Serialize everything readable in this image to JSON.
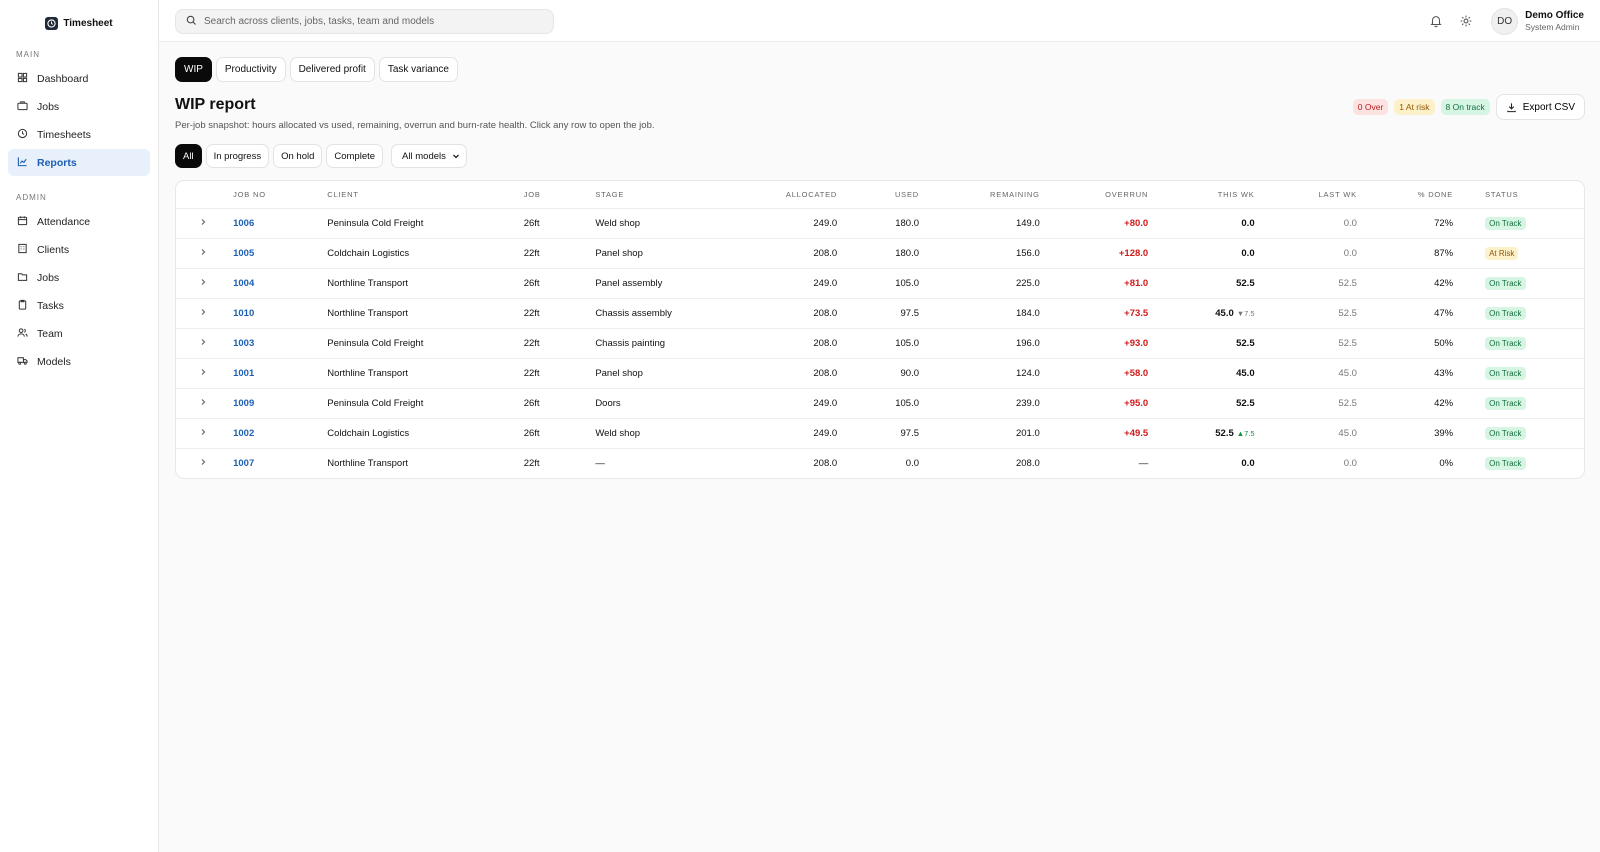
{
  "app": {
    "name": "Timesheet"
  },
  "sidebar": {
    "main_heading": "MAIN",
    "main_items": [
      {
        "label": "Dashboard",
        "icon": "dashboard-icon"
      },
      {
        "label": "Jobs",
        "icon": "briefcase-icon"
      },
      {
        "label": "Timesheets",
        "icon": "clock-icon"
      },
      {
        "label": "Reports",
        "icon": "chart-line-icon",
        "active": true
      }
    ],
    "admin_heading": "ADMIN",
    "admin_items": [
      {
        "label": "Attendance",
        "icon": "calendar-icon"
      },
      {
        "label": "Clients",
        "icon": "building-icon"
      },
      {
        "label": "Jobs",
        "icon": "folder-icon"
      },
      {
        "label": "Tasks",
        "icon": "clipboard-icon"
      },
      {
        "label": "Team",
        "icon": "users-icon"
      },
      {
        "label": "Models",
        "icon": "truck-icon"
      }
    ]
  },
  "topbar": {
    "search_placeholder": "Search across clients, jobs, tasks, team and models",
    "user": {
      "initials": "DO",
      "name": "Demo Office",
      "role": "System Admin"
    }
  },
  "report_tabs": [
    "WIP",
    "Productivity",
    "Delivered profit",
    "Task variance"
  ],
  "page": {
    "title": "WIP report",
    "subtitle": "Per-job snapshot: hours allocated vs used, remaining, overrun and burn-rate health. Click any row to open the job.",
    "summary": {
      "over": "0 Over",
      "at_risk": "1 At risk",
      "on_track": "8 On track"
    },
    "export_label": "Export CSV"
  },
  "filters": [
    "All",
    "In progress",
    "On hold",
    "Complete"
  ],
  "model_select": {
    "value": "All models"
  },
  "table": {
    "columns": [
      "JOB NO",
      "CLIENT",
      "JOB",
      "STAGE",
      "ALLOCATED",
      "USED",
      "REMAINING",
      "OVERRUN",
      "THIS WK",
      "LAST WK",
      "% DONE",
      "STATUS"
    ],
    "rows": [
      {
        "job_no": "1006",
        "client": "Peninsula Cold Freight",
        "job": "26ft",
        "stage": "Weld shop",
        "allocated": "249.0",
        "used": "180.0",
        "remaining": "149.0",
        "overrun": "+80.0",
        "this_wk": "0.0",
        "delta": "",
        "delta_dir": "",
        "last_wk": "0.0",
        "done": "72%",
        "status": "On Track",
        "status_kind": "ontrack"
      },
      {
        "job_no": "1005",
        "client": "Coldchain Logistics",
        "job": "22ft",
        "stage": "Panel shop",
        "allocated": "208.0",
        "used": "180.0",
        "remaining": "156.0",
        "overrun": "+128.0",
        "this_wk": "0.0",
        "delta": "",
        "delta_dir": "",
        "last_wk": "0.0",
        "done": "87%",
        "status": "At Risk",
        "status_kind": "atrisk"
      },
      {
        "job_no": "1004",
        "client": "Northline Transport",
        "job": "26ft",
        "stage": "Panel assembly",
        "allocated": "249.0",
        "used": "105.0",
        "remaining": "225.0",
        "overrun": "+81.0",
        "this_wk": "52.5",
        "delta": "",
        "delta_dir": "",
        "last_wk": "52.5",
        "done": "42%",
        "status": "On Track",
        "status_kind": "ontrack"
      },
      {
        "job_no": "1010",
        "client": "Northline Transport",
        "job": "22ft",
        "stage": "Chassis assembly",
        "allocated": "208.0",
        "used": "97.5",
        "remaining": "184.0",
        "overrun": "+73.5",
        "this_wk": "45.0",
        "delta": "▼7.5",
        "delta_dir": "down",
        "last_wk": "52.5",
        "done": "47%",
        "status": "On Track",
        "status_kind": "ontrack"
      },
      {
        "job_no": "1003",
        "client": "Peninsula Cold Freight",
        "job": "22ft",
        "stage": "Chassis painting",
        "allocated": "208.0",
        "used": "105.0",
        "remaining": "196.0",
        "overrun": "+93.0",
        "this_wk": "52.5",
        "delta": "",
        "delta_dir": "",
        "last_wk": "52.5",
        "done": "50%",
        "status": "On Track",
        "status_kind": "ontrack"
      },
      {
        "job_no": "1001",
        "client": "Northline Transport",
        "job": "22ft",
        "stage": "Panel shop",
        "allocated": "208.0",
        "used": "90.0",
        "remaining": "124.0",
        "overrun": "+58.0",
        "this_wk": "45.0",
        "delta": "",
        "delta_dir": "",
        "last_wk": "45.0",
        "done": "43%",
        "status": "On Track",
        "status_kind": "ontrack"
      },
      {
        "job_no": "1009",
        "client": "Peninsula Cold Freight",
        "job": "26ft",
        "stage": "Doors",
        "allocated": "249.0",
        "used": "105.0",
        "remaining": "239.0",
        "overrun": "+95.0",
        "this_wk": "52.5",
        "delta": "",
        "delta_dir": "",
        "last_wk": "52.5",
        "done": "42%",
        "status": "On Track",
        "status_kind": "ontrack"
      },
      {
        "job_no": "1002",
        "client": "Coldchain Logistics",
        "job": "26ft",
        "stage": "Weld shop",
        "allocated": "249.0",
        "used": "97.5",
        "remaining": "201.0",
        "overrun": "+49.5",
        "this_wk": "52.5",
        "delta": "▲7.5",
        "delta_dir": "up",
        "last_wk": "45.0",
        "done": "39%",
        "status": "On Track",
        "status_kind": "ontrack"
      },
      {
        "job_no": "1007",
        "client": "Northline Transport",
        "job": "22ft",
        "stage": "—",
        "allocated": "208.0",
        "used": "0.0",
        "remaining": "208.0",
        "overrun": "—",
        "this_wk": "0.0",
        "delta": "",
        "delta_dir": "",
        "last_wk": "0.0",
        "done": "0%",
        "status": "On Track",
        "status_kind": "ontrack"
      }
    ]
  },
  "colors": {
    "accent": "#1d5fb3",
    "overrun": "#d11a1a",
    "on_track": "#13703f",
    "at_risk": "#92560a"
  }
}
